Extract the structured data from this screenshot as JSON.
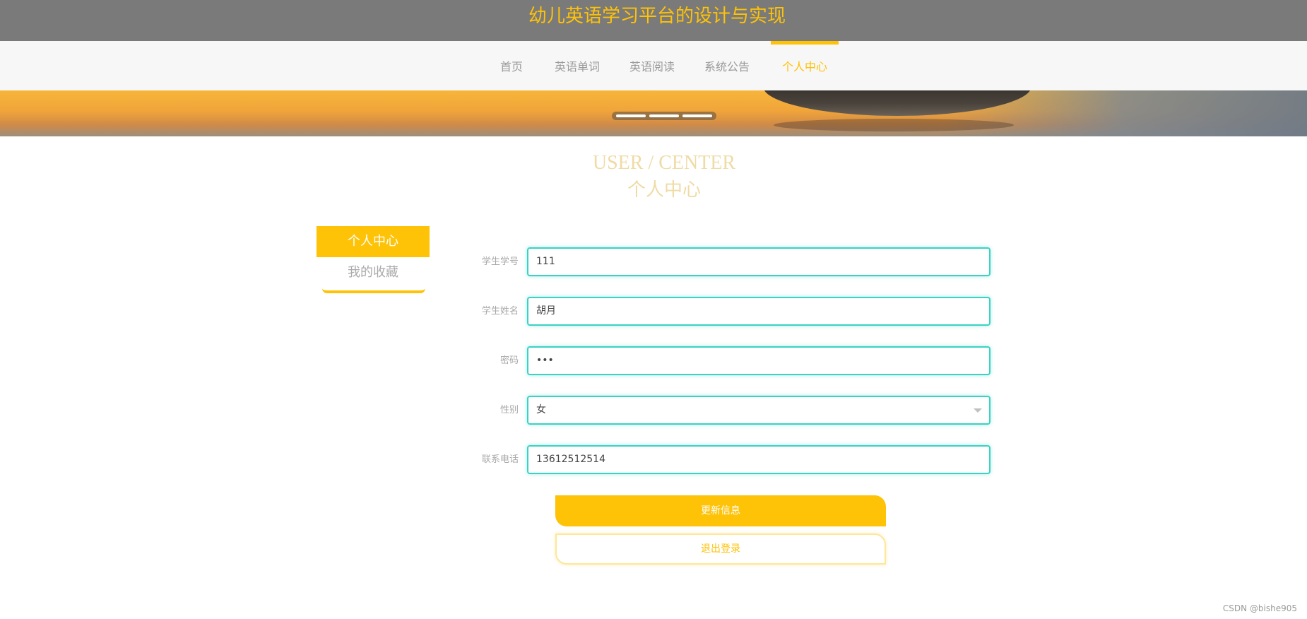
{
  "header": {
    "site_title": "幼儿英语学习平台的设计与实现"
  },
  "nav": {
    "items": [
      {
        "label": "首页"
      },
      {
        "label": "英语单词"
      },
      {
        "label": "英语阅读"
      },
      {
        "label": "系统公告"
      },
      {
        "label": "个人中心"
      }
    ],
    "active_index": 4
  },
  "banner": {
    "slide_count": 3
  },
  "section": {
    "title_en": "USER / CENTER",
    "title_cn": "个人中心"
  },
  "side_menu": {
    "items": [
      {
        "label": "个人中心"
      },
      {
        "label": "我的收藏"
      }
    ],
    "active_index": 0
  },
  "form": {
    "student_id": {
      "label": "学生学号",
      "value": "111"
    },
    "student_name": {
      "label": "学生姓名",
      "value": "胡月"
    },
    "password": {
      "label": "密码",
      "value": "•••"
    },
    "gender": {
      "label": "性别",
      "value": "女"
    },
    "phone": {
      "label": "联系电话",
      "value": "13612512514"
    }
  },
  "buttons": {
    "update": "更新信息",
    "logout": "退出登录"
  },
  "watermark": "CSDN @bishe905",
  "colors": {
    "accent": "#fec207",
    "header_bg": "#7a7a7a",
    "nav_bg": "#f7f7f7",
    "input_border": "#3ad2c3"
  },
  "icons": {
    "select_caret": "chevron-down-icon"
  }
}
